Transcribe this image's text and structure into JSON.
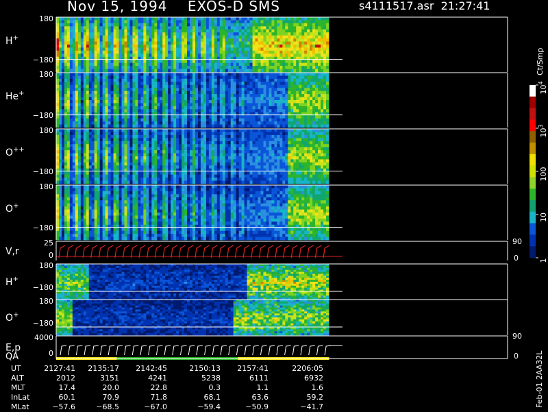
{
  "header": {
    "title": "Nov 15, 1994    EXOS-D SMS",
    "file": "s4111517.asr  21:27:41"
  },
  "chart_data": {
    "type": "heatmap",
    "panels": [
      {
        "label": "H",
        "sup": "+",
        "ytop": "180",
        "ybot": "−180",
        "kind": "spectro",
        "profile": "h1"
      },
      {
        "label": "He",
        "sup": "+",
        "ytop": "180",
        "ybot": "−180",
        "kind": "spectro",
        "profile": "he"
      },
      {
        "label": "O",
        "sup": "++",
        "ytop": "180",
        "ybot": "−180",
        "kind": "spectro",
        "profile": "opp"
      },
      {
        "label": "O",
        "sup": "+",
        "ytop": "180",
        "ybot": "−180",
        "kind": "spectro",
        "profile": "op"
      },
      {
        "label": "V,r",
        "sup": "",
        "ytop": "25",
        "ybot": "0",
        "kind": "line",
        "right_top": "90",
        "right_bot": "0"
      },
      {
        "label": "H",
        "sup": "+",
        "ytop": "180",
        "ybot": "−180",
        "kind": "spectro",
        "profile": "h2"
      },
      {
        "label": "O",
        "sup": "+",
        "ytop": "180",
        "ybot": "−180",
        "kind": "spectro",
        "profile": "o2"
      },
      {
        "label": "E,p",
        "sup": "",
        "ytop": "4000",
        "ybot": "0",
        "kind": "energy",
        "right_top": "90",
        "right_bot": "0",
        "label2": "QA"
      }
    ],
    "colorbar": {
      "unit": "Ct/Smp",
      "ticks": [
        {
          "base": "10",
          "exp": "4",
          "value": 10000
        },
        {
          "base": "10",
          "exp": "3",
          "value": 1000
        },
        {
          "base": "100",
          "exp": "",
          "value": 100
        },
        {
          "base": "10",
          "exp": "",
          "value": 10
        },
        {
          "base": "1",
          "exp": "",
          "value": 1
        }
      ],
      "range": [
        1,
        10000
      ]
    },
    "time_axis": {
      "labels": [
        "UT",
        "ALT",
        "MLT",
        "InLat",
        "MLat"
      ],
      "columns": [
        {
          "UT": "2127:41",
          "ALT": "2012",
          "MLT": "17.4",
          "InLat": "60.1",
          "MLat": "−57.6"
        },
        {
          "UT": "2135:17",
          "ALT": "3151",
          "MLT": "20.0",
          "InLat": "70.9",
          "MLat": "−68.5"
        },
        {
          "UT": "2142:45",
          "ALT": "4241",
          "MLT": "22.8",
          "InLat": "71.8",
          "MLat": "−67.0"
        },
        {
          "UT": "2150:13",
          "ALT": "5238",
          "MLT": "0.3",
          "InLat": "68.1",
          "MLat": "−59.4"
        },
        {
          "UT": "2157:41",
          "ALT": "6111",
          "MLT": "1.1",
          "InLat": "63.6",
          "MLat": "−50.9"
        },
        {
          "UT": "2206:05",
          "ALT": "6932",
          "MLT": "1.6",
          "InLat": "59.2",
          "MLat": "−41.7"
        }
      ]
    }
  },
  "stamp": "Feb-01 2AA32L"
}
